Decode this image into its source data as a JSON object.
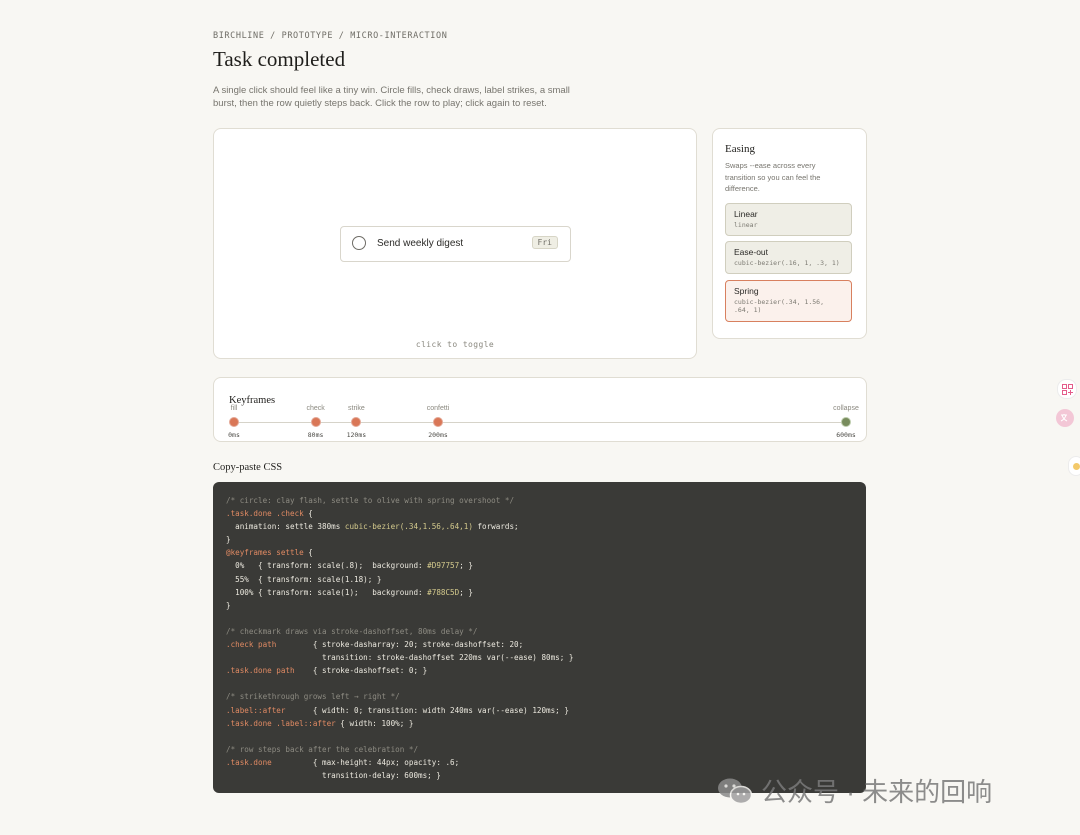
{
  "header": {
    "breadcrumb": "BIRCHLINE / PROTOTYPE / MICRO-INTERACTION",
    "title": "Task completed",
    "description": "A single click should feel like a tiny win. Circle fills, check draws, label strikes, a small burst, then the row quietly steps back. Click the row to play; click again to reset."
  },
  "stage": {
    "task_label": "Send weekly digest",
    "due_chip": "Fri",
    "hint": "click to toggle",
    "checkbox_icon": "circle-checkbox-icon"
  },
  "easing": {
    "title": "Easing",
    "description": "Swaps --ease across every transition so you can feel the difference.",
    "selected": "Spring",
    "options": [
      {
        "name": "Linear",
        "fn": "linear"
      },
      {
        "name": "Ease-out",
        "fn": "cubic-bezier(.16, 1, .3, 1)"
      },
      {
        "name": "Spring",
        "fn": "cubic-bezier(.34, 1.56, .64, 1)"
      }
    ]
  },
  "keyframes": {
    "title": "Keyframes",
    "timeline_end_ms": 600,
    "markers": [
      {
        "label": "fill",
        "time": "0ms",
        "ms": 0,
        "color": "#D97757"
      },
      {
        "label": "check",
        "time": "80ms",
        "ms": 80,
        "color": "#D97757"
      },
      {
        "label": "strike",
        "time": "120ms",
        "ms": 120,
        "color": "#D97757"
      },
      {
        "label": "confetti",
        "time": "200ms",
        "ms": 200,
        "color": "#D97757"
      },
      {
        "label": "collapse",
        "time": "600ms",
        "ms": 600,
        "color": "#788C5D"
      }
    ]
  },
  "css": {
    "heading": "Copy-paste CSS",
    "lines": [
      "/* circle: clay flash, settle to olive with spring overshoot */",
      ".task.done .check {",
      "  animation: settle 380ms cubic-bezier(.34,1.56,.64,1) forwards;",
      "}",
      "@keyframes settle {",
      "  0%   { transform: scale(.8);  background: #D97757; }",
      "  55%  { transform: scale(1.18); }",
      "  100% { transform: scale(1);   background: #788C5D; }",
      "}",
      "",
      "/* checkmark draws via stroke-dashoffset, 80ms delay */",
      ".check path        { stroke-dasharray: 20; stroke-dashoffset: 20;",
      "                     transition: stroke-dashoffset 220ms var(--ease) 80ms; }",
      ".task.done path    { stroke-dashoffset: 0; }",
      "",
      "/* strikethrough grows left → right */",
      ".label::after      { width: 0; transition: width 240ms var(--ease) 120ms; }",
      ".task.done .label::after { width: 100%; }",
      "",
      "/* row steps back after the celebration */",
      ".task.done         { max-height: 44px; opacity: .6;",
      "                     transition-delay: 600ms; }"
    ]
  },
  "watermark": {
    "text": "公众号 · 未来的回响",
    "icon": "wechat-icon"
  },
  "colors": {
    "clay": "#D97757",
    "olive": "#788C5D",
    "code_bg": "#3A3A37",
    "page_bg": "#F8F7F3"
  }
}
